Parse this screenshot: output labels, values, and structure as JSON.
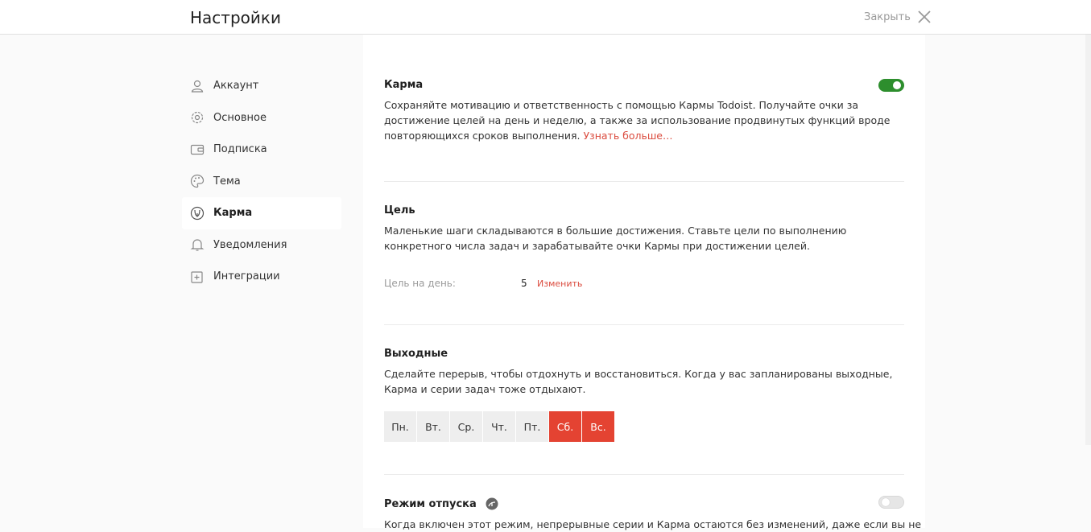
{
  "header": {
    "title": "Настройки",
    "close_label": "Закрыть"
  },
  "sidebar": {
    "items": [
      {
        "label": "Аккаунт",
        "icon": "user-icon"
      },
      {
        "label": "Основное",
        "icon": "gear-icon"
      },
      {
        "label": "Подписка",
        "icon": "wallet-icon"
      },
      {
        "label": "Тема",
        "icon": "palette-icon"
      },
      {
        "label": "Карма",
        "icon": "karma-icon",
        "active": true
      },
      {
        "label": "Уведомления",
        "icon": "bell-icon"
      },
      {
        "label": "Интеграции",
        "icon": "plus-square-icon"
      }
    ]
  },
  "karma": {
    "title": "Карма",
    "enabled": true,
    "description": "Сохраняйте мотивацию и ответственность с помощью Кармы Todoist. Получайте очки за достижение целей на день и неделю, а также за использование продвинутых функций вроде повторяющихся сроков выполнения.",
    "more_link": "Узнать больше…"
  },
  "goal": {
    "title": "Цель",
    "description": "Маленькие шаги складываются в большие достижения. Ставьте цели по выполнению конкретного числа задач и зарабатывайте очки Кармы при достижении целей.",
    "daily_label": "Цель на день:",
    "daily_value": "5",
    "change_label": "Изменить"
  },
  "days_off": {
    "title": "Выходные",
    "description": "Сделайте перерыв, чтобы отдохнуть и восстановиться. Когда у вас запланированы выходные, Карма и серии задач тоже отдыхают.",
    "days": [
      {
        "label": "Пн.",
        "selected": false
      },
      {
        "label": "Вт.",
        "selected": false
      },
      {
        "label": "Ср.",
        "selected": false
      },
      {
        "label": "Чт.",
        "selected": false
      },
      {
        "label": "Пт.",
        "selected": false
      },
      {
        "label": "Сб.",
        "selected": true
      },
      {
        "label": "Вс.",
        "selected": true
      }
    ],
    "selected_color": "#e44332"
  },
  "vacation": {
    "title": "Режим отпуска",
    "enabled": false,
    "description": "Когда включен этот режим, непрерывные серии и Карма остаются без изменений, даже если вы не"
  },
  "colors": {
    "accent": "#db4c3f",
    "toggle_on": "#2d8e2d"
  }
}
